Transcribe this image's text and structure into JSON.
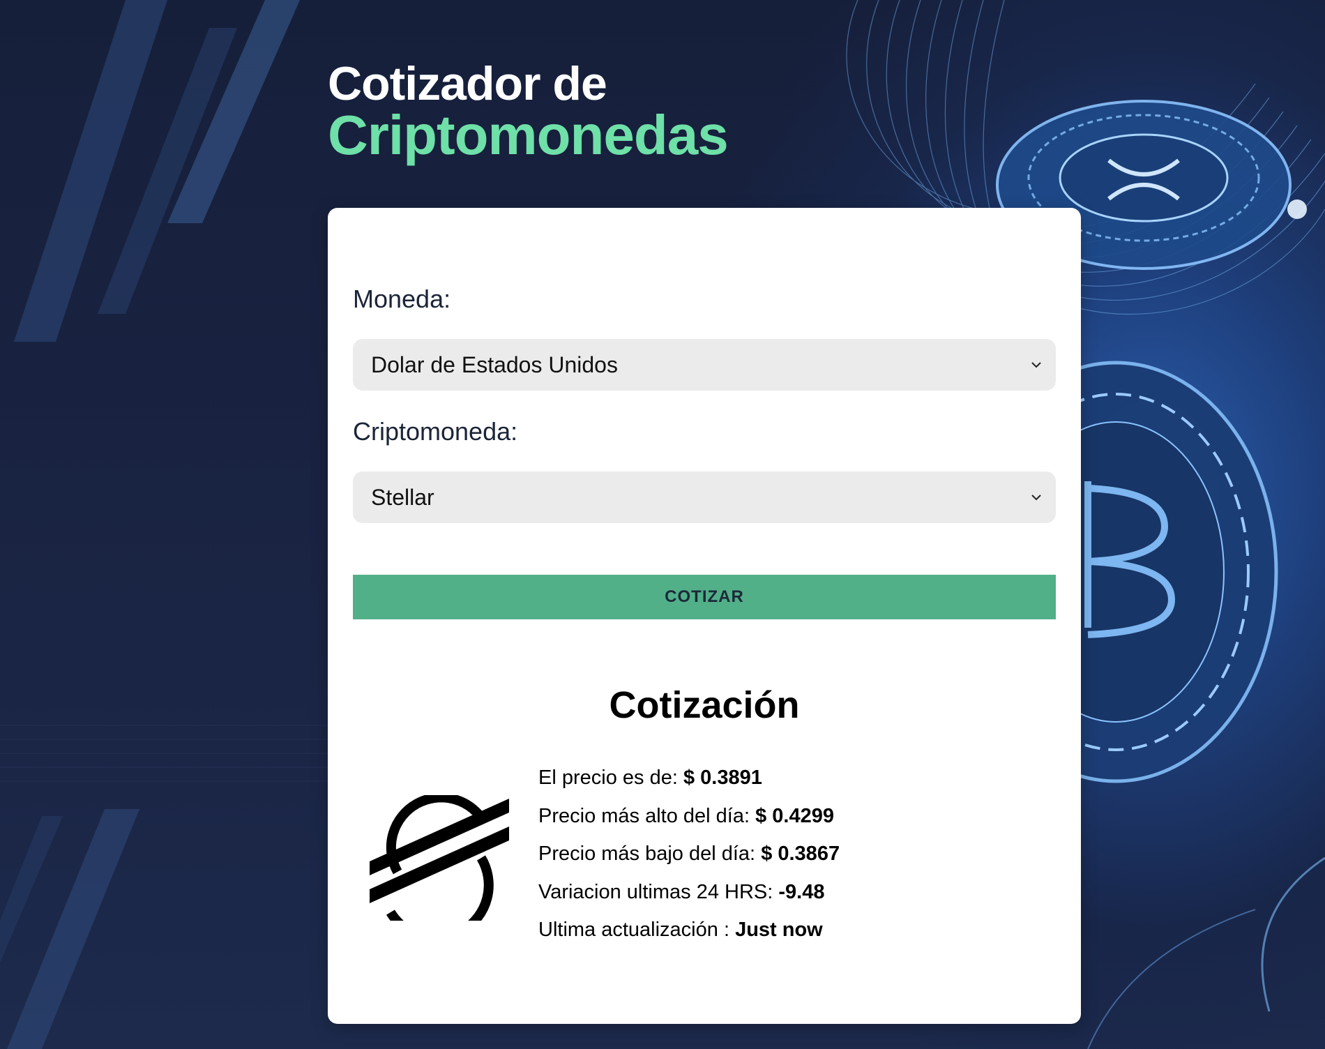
{
  "header": {
    "title_line1": "Cotizador de",
    "title_line2": "Criptomonedas"
  },
  "form": {
    "currency_label": "Moneda:",
    "currency_selected": "Dolar de Estados Unidos",
    "crypto_label": "Criptomoneda:",
    "crypto_selected": "Stellar",
    "submit_label": "COTIZAR"
  },
  "result": {
    "title": "Cotización",
    "coin_icon": "stellar-logo-icon",
    "price_label": "El precio es de:",
    "price_value": "$ 0.3891",
    "high_label": "Precio más alto del día:",
    "high_value": "$ 0.4299",
    "low_label": "Precio más bajo del día:",
    "low_value": "$ 0.3867",
    "change_label": "Variacion ultimas 24 HRS:",
    "change_value": "-9.48",
    "updated_label": "Ultima actualización :",
    "updated_value": "Just now"
  },
  "colors": {
    "accent": "#6ee0a8",
    "button": "#52b089",
    "background": "#1a2340"
  }
}
